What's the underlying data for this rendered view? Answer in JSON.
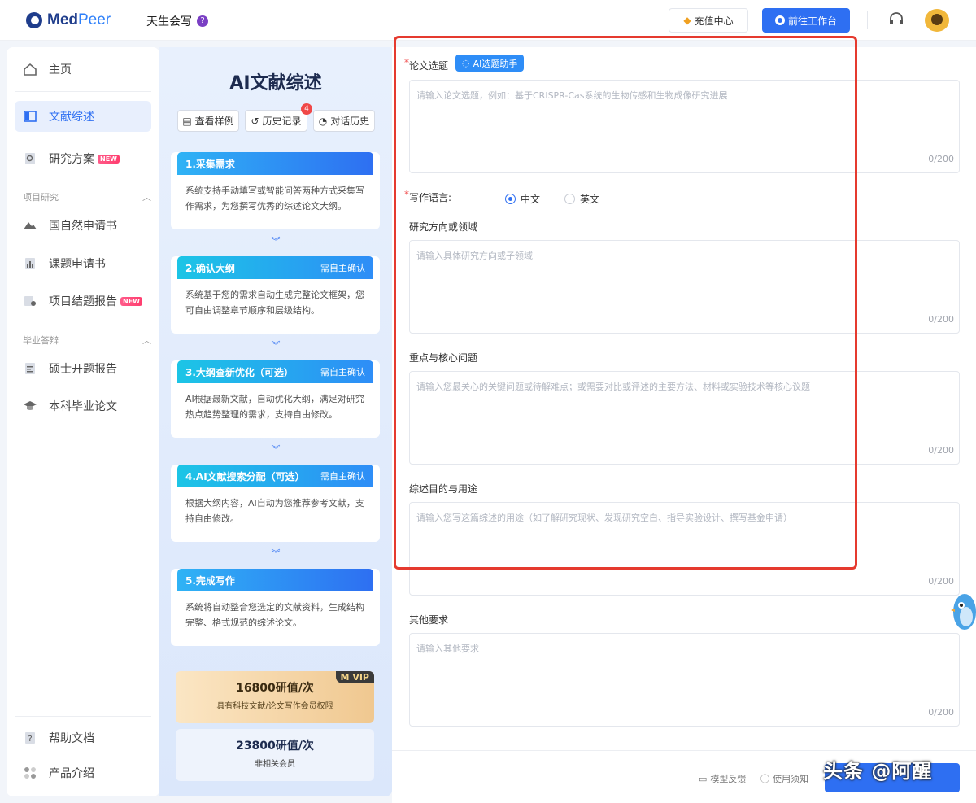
{
  "header": {
    "logo_text_a": "Med",
    "logo_text_b": "Peer",
    "team_name": "天生会写",
    "team_badge": "?",
    "recharge_label": "充值中心",
    "workbench_label": "前往工作台"
  },
  "sidebar": {
    "items": [
      {
        "label": "主页",
        "icon": "home-icon"
      },
      {
        "label": "文献综述",
        "icon": "book-icon",
        "active": true
      },
      {
        "label": "研究方案",
        "icon": "search-doc-icon",
        "tag": "NEW"
      },
      {
        "label": "国自然申请书",
        "icon": "mountain-icon"
      },
      {
        "label": "课题申请书",
        "icon": "bar-chart-icon"
      },
      {
        "label": "项目结题报告",
        "icon": "certificate-icon",
        "tag": "NEW"
      },
      {
        "label": "硕士开题报告",
        "icon": "document-icon"
      },
      {
        "label": "本科毕业论文",
        "icon": "graduation-cap-icon"
      },
      {
        "label": "帮助文档",
        "icon": "help-icon"
      },
      {
        "label": "产品介绍",
        "icon": "grid-icon"
      }
    ],
    "groups": {
      "research": "项目研究",
      "graduation": "毕业答辩"
    },
    "new_tag": "NEW"
  },
  "panel": {
    "title": "AI文献综述",
    "buttons": {
      "sample": "查看样例",
      "history": "历史记录",
      "chat_history": "对话历史"
    },
    "history_badge": "4",
    "steps": [
      {
        "title": "1.采集需求",
        "note": "",
        "body": "系统支持手动填写或智能问答两种方式采集写作需求，为您撰写优秀的综述论文大纲。"
      },
      {
        "title": "2.确认大纲",
        "note": "需自主确认",
        "body": "系统基于您的需求自动生成完整论文框架，您可自由调整章节顺序和层级结构。"
      },
      {
        "title": "3.大纲查新优化（可选）",
        "note": "需自主确认",
        "body": "AI根据最新文献，自动优化大纲，满足对研究热点趋势整理的需求，支持自由修改。"
      },
      {
        "title": "4.AI文献搜索分配（可选）",
        "note": "需自主确认",
        "body": "根据大纲内容，AI自动为您推荐参考文献，支持自由修改。"
      },
      {
        "title": "5.完成写作",
        "note": "",
        "body": "系统将自动整合您选定的文献资料，生成结构完整、格式规范的综述论文。"
      }
    ],
    "vip": {
      "price": "16800研值/次",
      "desc": "具有科技文献/论文写作会员权限",
      "tag": "M VIP"
    },
    "normal": {
      "price": "23800研值/次",
      "desc": "非相关会员"
    }
  },
  "form": {
    "topic": {
      "label": "论文选题",
      "assistant": "AI选题助手",
      "placeholder": "请输入论文选题，例如：基于CRISPR-Cas系统的生物传感和生物成像研究进展",
      "count": "0/200"
    },
    "language": {
      "label": "写作语言:",
      "options": [
        "中文",
        "英文"
      ],
      "selected": "中文"
    },
    "direction": {
      "label": "研究方向或领域",
      "placeholder": "请输入具体研究方向或子领域",
      "count": "0/200"
    },
    "focus": {
      "label": "重点与核心问题",
      "placeholder": "请输入您最关心的关键问题或待解难点；或需要对比或评述的主要方法、材料或实验技术等核心议题",
      "count": "0/200"
    },
    "purpose": {
      "label": "综述目的与用途",
      "placeholder": "请输入您写这篇综述的用途（如了解研究现状、发现研究空白、指导实验设计、撰写基金申请）",
      "count": "0/200"
    },
    "other": {
      "label": "其他要求",
      "placeholder": "请输入其他要求",
      "count": "0/200"
    }
  },
  "footer": {
    "feedback": "模型反馈",
    "notice": "使用须知",
    "watermark": "头条 @阿醒"
  },
  "colors": {
    "primary": "#2e6ff2",
    "highlight_box": "#e53a2f"
  }
}
